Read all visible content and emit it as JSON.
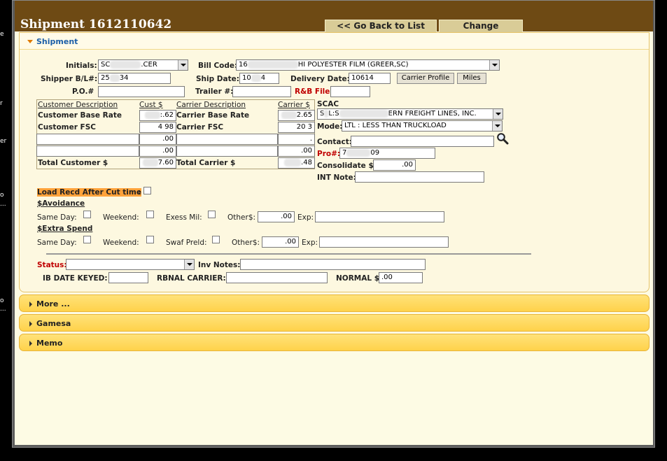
{
  "window": {
    "title": "Shipment 1612110642"
  },
  "nav": {
    "back_label": "<< Go Back to List",
    "change_label": "Change"
  },
  "left_fragments": [
    "e",
    "r",
    "er",
    "o",
    "...",
    "o",
    "..."
  ],
  "section": {
    "title": "Shipment"
  },
  "form": {
    "initials": {
      "label": "Initials:",
      "value_prefix": "SC",
      "value_suffix": ".CER"
    },
    "bill_code": {
      "label": "Bill Code:",
      "value_prefix": "16",
      "value_suffix": "HI POLYESTER FILM (GREER,SC)"
    },
    "shipper_bl": {
      "label": "Shipper B/L#:",
      "value_prefix": "25",
      "value_suffix": "34"
    },
    "ship_date": {
      "label": "Ship Date:",
      "value_prefix": "10",
      "value_suffix": "4"
    },
    "delivery_date": {
      "label": "Delivery Date:",
      "value": "10614"
    },
    "carrier_profile_label": "Carrier Profile",
    "miles_label": "Miles",
    "po": {
      "label": "P.O.#",
      "value": ""
    },
    "trailer": {
      "label": "Trailer #:",
      "value": ""
    },
    "rb_file": {
      "label": "R&B File:",
      "value": ""
    }
  },
  "rates": {
    "headers": {
      "cust_desc": "Customer Description",
      "cust_amt": "Cust $",
      "carrier_desc": "Carrier Description",
      "carrier_amt": "Carrier $"
    },
    "rows": [
      {
        "cust_desc": "Customer Base Rate",
        "cust_amt": ":.62",
        "carrier_desc": "Carrier Base Rate",
        "carrier_amt": "2.65"
      },
      {
        "cust_desc": "Customer FSC",
        "cust_amt": "4 98",
        "carrier_desc": "Carrier FSC",
        "carrier_amt": "20 3"
      },
      {
        "cust_desc": "",
        "cust_amt": ".00",
        "carrier_desc": "",
        "carrier_amt": "."
      },
      {
        "cust_desc": "",
        "cust_amt": ".00",
        "carrier_desc": "",
        "carrier_amt": ".00"
      },
      {
        "cust_desc": "Total Customer $",
        "cust_amt": "7.60",
        "carrier_desc": "Total Carrier $",
        "carrier_amt": ".48"
      }
    ]
  },
  "carrier": {
    "scac_label": "SCAC",
    "scac_value_prefix": "S",
    "scac_value_mid": "L:S",
    "scac_value_suffix": "ERN FREIGHT LINES, INC.",
    "mode_label": "Mode:",
    "mode_value": "LTL : LESS THAN TRUCKLOAD",
    "contact_label": "Contact:",
    "contact_value": "",
    "pro_label": "Pro#:",
    "pro_value_prefix": "7",
    "pro_value_suffix": "09",
    "consolidate_label": "Consolidate $:",
    "consolidate_value": ".00",
    "int_note_label": "INT Note:",
    "int_note_value": ""
  },
  "flags": {
    "load_recd_label": "Load Recd After Cut time",
    "avoidance_label": "$Avoidance",
    "extra_spend_label": "$Extra Spend",
    "same_day": "Same Day:",
    "weekend": "Weekend:",
    "exess_mil": "Exess Mil:",
    "swaf_preld": "Swaf Preld:",
    "other": "Other$:",
    "exp": "Exp:",
    "avoid_other_value": ".00",
    "extra_other_value": ".00",
    "avoid_exp_value": "",
    "extra_exp_value": ""
  },
  "status": {
    "status_label": "Status:",
    "status_value": "",
    "inv_notes_label": "Inv Notes:",
    "inv_notes_value": "",
    "ib_date_label": "IB DATE KEYED:",
    "ib_date_value": "",
    "rbnal_label": "RBNAL CARRIER:",
    "rbnal_value": "",
    "normal_label": "NORMAL $:",
    "normal_value": ".00"
  },
  "accordions": [
    "More ...",
    "Gamesa",
    "Memo"
  ],
  "colors": {
    "title_bar": "#6e4a14",
    "section_title": "#1c5fa8",
    "highlight": "#ffa23a",
    "required": "#c00000",
    "accordion": "#ffd24a"
  }
}
